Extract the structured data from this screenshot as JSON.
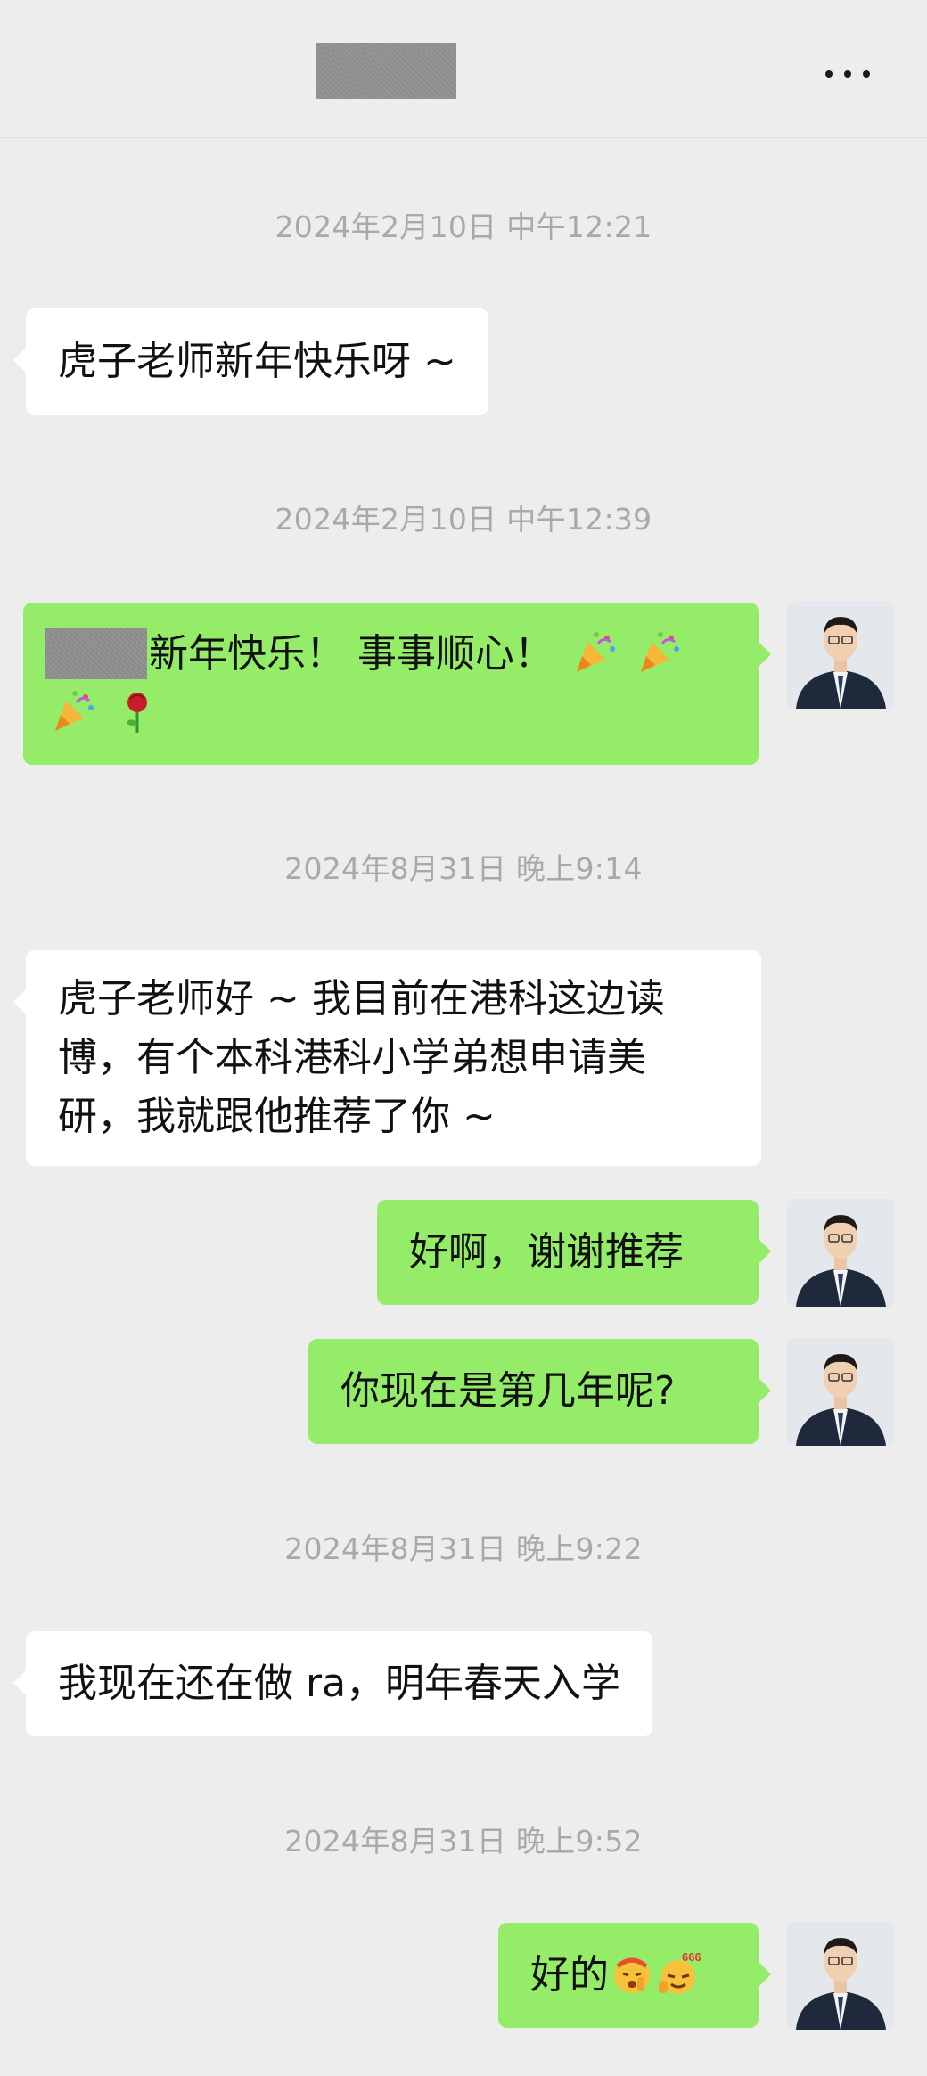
{
  "header": {
    "more_icon": "more-dots-icon"
  },
  "messages": {
    "t1": "2024年2月10日 中午12:21",
    "m1": "虎子老师新年快乐呀 ~",
    "t2": "2024年2月10日 中午12:39",
    "m2_line1": "新年快乐！ 事事顺心！",
    "m2_emoji": [
      "party-popper-icon",
      "party-popper-icon",
      "party-popper-icon",
      "rose-icon"
    ],
    "t3": "2024年8月31日 晚上9:14",
    "m3_lines": [
      "虎子老师好 ~ 我目前在港科这边读",
      "博，有个本科港科小学弟想申请美",
      "研，我就跟他推荐了你 ~"
    ],
    "m4": "好啊，谢谢推荐",
    "m5": "你现在是第几年呢?",
    "t4": "2024年8月31日 晚上9:22",
    "m6": "我现在还在做 ra，明年春天入学",
    "t5": "2024年8月31日 晚上9:52",
    "m7": "好的",
    "m7_emoji": [
      "shushing-face-icon",
      "666-face-icon"
    ]
  },
  "colors": {
    "background": "#ededed",
    "bubble_self": "#95ec69",
    "bubble_other": "#ffffff",
    "timestamp": "#a9a9a9"
  }
}
